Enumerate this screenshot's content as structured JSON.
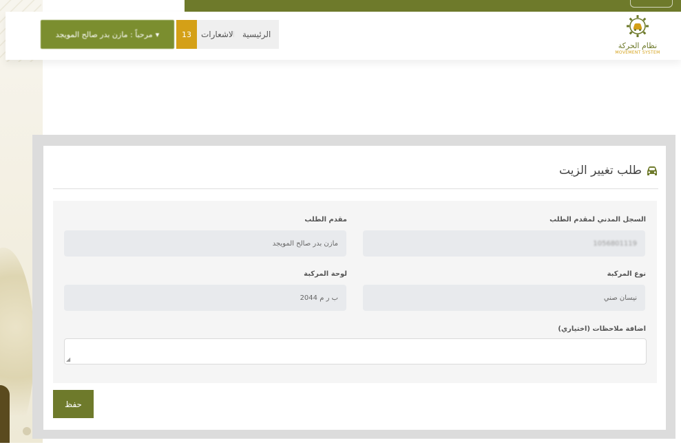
{
  "header": {
    "home_label": "الرئيسية",
    "notifications_label": "الاشعارات",
    "notifications_count": "13",
    "user_menu_label": "مرحباً : مازن بدر صالح المويجد"
  },
  "logo": {
    "name_ar": "نظام الحركة",
    "name_en": "MOVEMENT SYSTEM"
  },
  "form": {
    "title": "طلب تغيير الزيت",
    "fields": {
      "civil_id": {
        "label": "السجل المدني لمقدم الطلب",
        "value": "1056801119"
      },
      "applicant": {
        "label": "مقدم الطلب",
        "value": "مازن بدر صالح المويجد"
      },
      "vehicle_type": {
        "label": "نوع المركبة",
        "value": "نيسان صني"
      },
      "vehicle_plate": {
        "label": "لوحة المركبة",
        "value": "ب ر م 2044"
      },
      "notes": {
        "label": "اضافة ملاحظات (اختياري)",
        "value": ""
      }
    },
    "save_label": "حفظ"
  },
  "colors": {
    "brand_olive": "#6e7a2b",
    "brand_gold": "#d4a017",
    "input_bg": "#e8eaed"
  },
  "icons": {
    "title_icon": "car-icon",
    "logo_icon": "gear-car-icon"
  }
}
